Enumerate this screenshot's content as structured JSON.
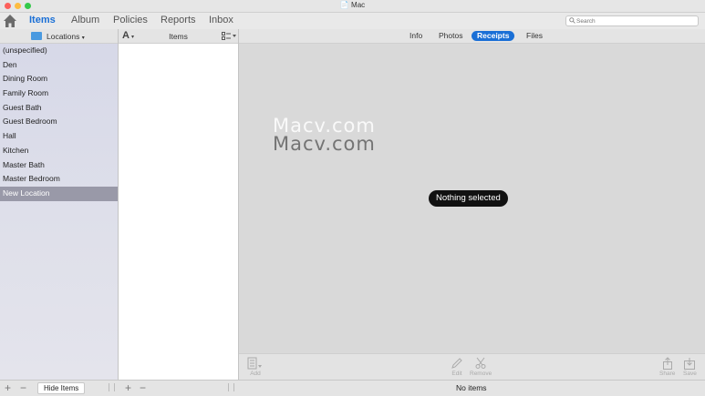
{
  "window": {
    "title": "Mac"
  },
  "toolbar": {
    "home_icon": "home-icon",
    "tabs": [
      {
        "label": "Items",
        "active": true
      },
      {
        "label": "Album",
        "active": false
      },
      {
        "label": "Policies",
        "active": false
      },
      {
        "label": "Reports",
        "active": false
      },
      {
        "label": "Inbox",
        "active": false
      }
    ],
    "search_placeholder": "Search"
  },
  "sidebar": {
    "header_label": "Locations",
    "locations": [
      "(unspecified)",
      "Den",
      "Dining Room",
      "Family Room",
      "Guest Bath",
      "Guest Bedroom",
      "Hall",
      "Kitchen",
      "Master Bath",
      "Master Bedroom",
      "New Location"
    ],
    "selected_index": 10
  },
  "items_column": {
    "sort_label": "A",
    "header_label": "Items"
  },
  "detail": {
    "tabs": [
      "Info",
      "Photos",
      "Receipts",
      "Files"
    ],
    "active_tab": "Receipts",
    "watermark_1": "Macv.com",
    "watermark_2": "Macv.com",
    "empty_message": "Nothing selected",
    "bottom_toolbar": {
      "add": "Add",
      "edit": "Edit",
      "remove": "Remove",
      "share": "Share",
      "save": "Save"
    }
  },
  "statusbar": {
    "add_symbol": "+",
    "remove_symbol": "−",
    "hide_items_label": "Hide Items",
    "add_symbol_2": "+",
    "remove_symbol_2": "−",
    "status_text": "No items"
  },
  "colors": {
    "accent": "#1a6fd6",
    "selection": "#9999a8",
    "pill": "#111111"
  }
}
